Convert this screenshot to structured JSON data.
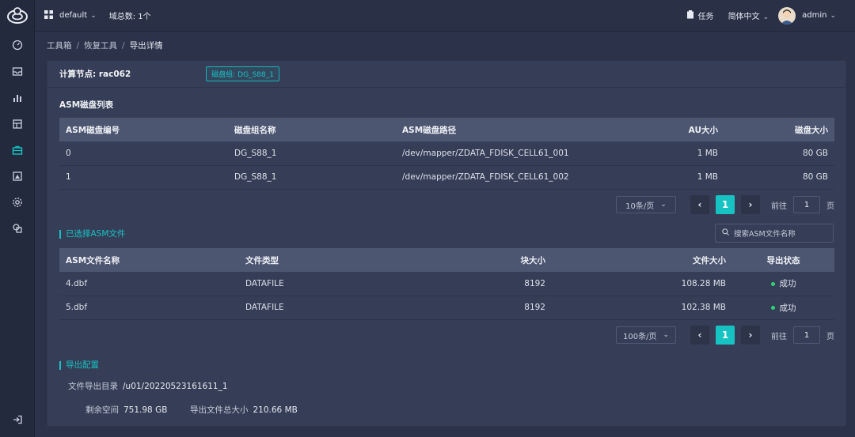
{
  "topbar": {
    "workspace": "default",
    "domain_count": "域总数: 1个",
    "tasks": "任务",
    "language": "简体中文",
    "user": "admin"
  },
  "breadcrumb": [
    "工具箱",
    "恢复工具",
    "导出详情"
  ],
  "panel": {
    "compute_node_label": "计算节点: rac062",
    "diskgroup_tag": "磁盘组: DG_S88_1"
  },
  "asm_disks": {
    "title": "ASM磁盘列表",
    "headers": [
      "ASM磁盘编号",
      "磁盘组名称",
      "ASM磁盘路径",
      "AU大小",
      "磁盘大小"
    ],
    "rows": [
      [
        "0",
        "DG_S88_1",
        "/dev/mapper/ZDATA_FDISK_CELL61_001",
        "1 MB",
        "80 GB"
      ],
      [
        "1",
        "DG_S88_1",
        "/dev/mapper/ZDATA_FDISK_CELL61_002",
        "1 MB",
        "80 GB"
      ]
    ],
    "pager": {
      "page_size": "10条/页",
      "current": "1",
      "goto_label": "前往",
      "goto_value": "1",
      "page_unit": "页"
    }
  },
  "asm_files": {
    "title": "已选择ASM文件",
    "search_placeholder": "搜索ASM文件名称",
    "headers": [
      "ASM文件名称",
      "文件类型",
      "块大小",
      "文件大小",
      "导出状态"
    ],
    "rows": [
      [
        "4.dbf",
        "DATAFILE",
        "8192",
        "108.28 MB",
        "成功"
      ],
      [
        "5.dbf",
        "DATAFILE",
        "8192",
        "102.38 MB",
        "成功"
      ]
    ],
    "pager": {
      "page_size": "100条/页",
      "current": "1",
      "goto_label": "前往",
      "goto_value": "1",
      "page_unit": "页"
    }
  },
  "export_config": {
    "title": "导出配置",
    "dir_label": "文件导出目录",
    "dir_value": "/u01/20220523161611_1",
    "free_label": "剩余空间",
    "free_value": "751.98 GB",
    "total_label": "导出文件总大小",
    "total_value": "210.66 MB"
  },
  "colors": {
    "accent": "#17c2c2",
    "success": "#2fd47a",
    "background": "#2b3249",
    "panel": "#363e57"
  }
}
